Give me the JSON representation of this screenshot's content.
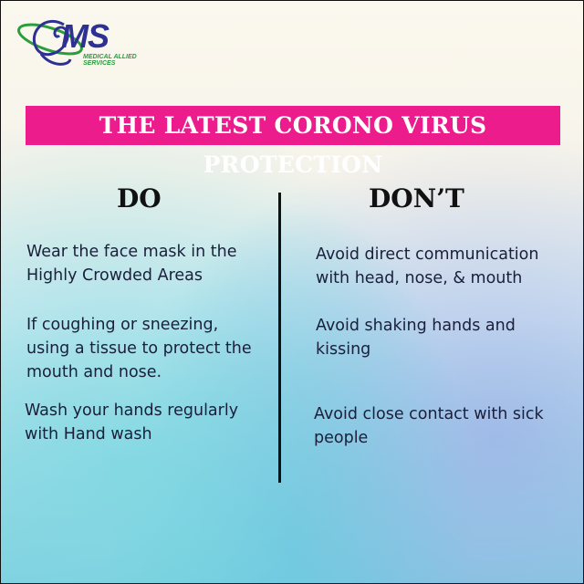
{
  "logo": {
    "letters": "MS",
    "tagline": "MEDICAL ALLIED SERVICES",
    "colors": {
      "primary": "#2e3192",
      "accent": "#2a9d3c"
    }
  },
  "banner": {
    "title": "THE LATEST CORONO VIRUS PROTECTION",
    "color": "#ec1c8c"
  },
  "do": {
    "heading": "DO",
    "items": [
      "Wear the face mask in the Highly Crowded Areas",
      "If coughing or sneezing, using a tissue to protect the mouth and nose.",
      "Wash your hands regularly with Hand wash"
    ]
  },
  "dont": {
    "heading": "DON’T",
    "items": [
      "Avoid direct communication with head, nose, & mouth",
      "Avoid shaking hands and kissing",
      "Avoid close contact with sick people"
    ]
  }
}
